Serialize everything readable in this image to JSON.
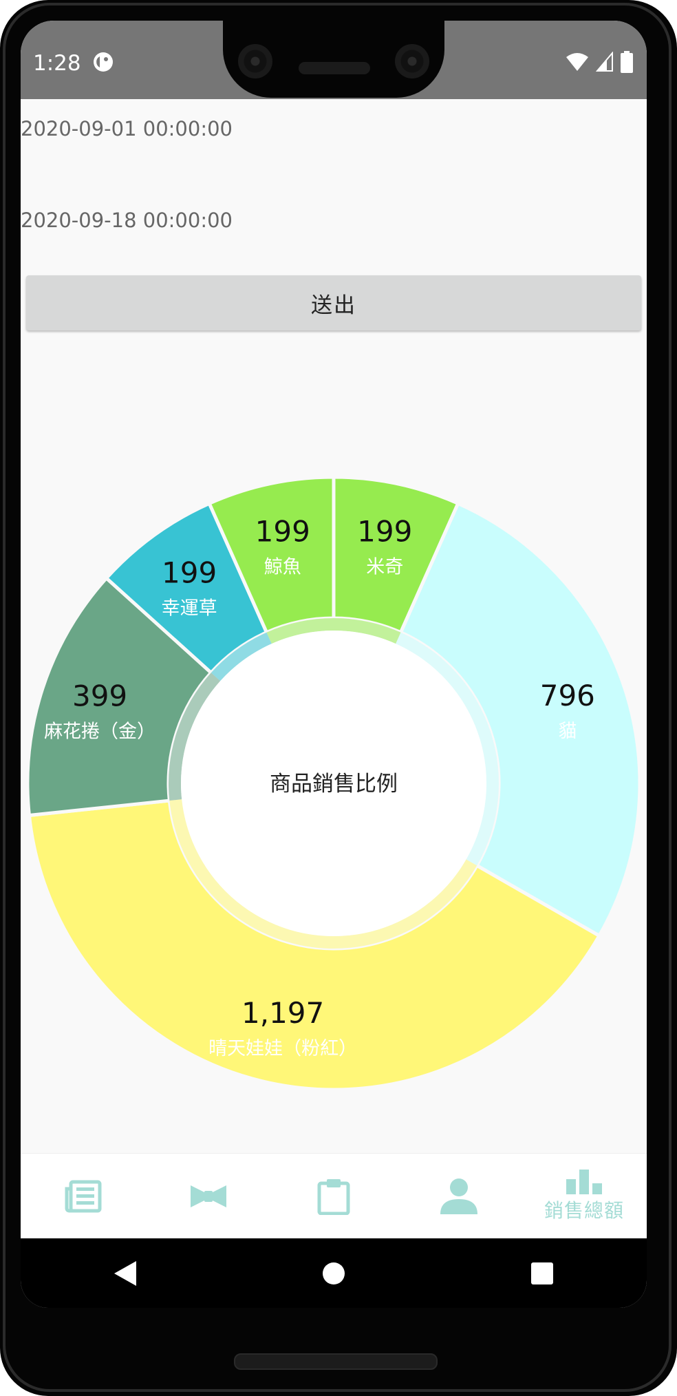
{
  "status_bar": {
    "time": "1:28",
    "app_icon": "app-notification-icon",
    "right_icons": [
      "wifi-icon",
      "cell-signal-icon",
      "battery-icon"
    ],
    "background_color": "#767676"
  },
  "form": {
    "start_date": "2020-09-01 00:00:00",
    "end_date": "2020-09-18 00:00:00",
    "submit_label": "送出"
  },
  "chart_data": {
    "type": "pie",
    "center_label": "商品銷售比例",
    "slices": [
      {
        "label": "米奇",
        "value": 199,
        "value_text": "199",
        "color": "#96eb4f"
      },
      {
        "label": "貓",
        "value": 796,
        "value_text": "796",
        "color": "#c9fdfd"
      },
      {
        "label": "晴天娃娃（粉紅）",
        "value": 1197,
        "value_text": "1,197",
        "color": "#fff778"
      },
      {
        "label": "麻花捲（金）",
        "value": 399,
        "value_text": "399",
        "color": "#6aa687"
      },
      {
        "label": "幸運草",
        "value": 199,
        "value_text": "199",
        "color": "#38c3d3"
      },
      {
        "label": "鯨魚",
        "value": 199,
        "value_text": "199",
        "color": "#96eb4f"
      }
    ]
  },
  "bottom_nav": {
    "items": [
      {
        "icon": "news-icon"
      },
      {
        "icon": "bow-tie-icon"
      },
      {
        "icon": "clipboard-icon"
      },
      {
        "icon": "person-icon"
      },
      {
        "icon": "bar-chart-icon",
        "label": "銷售總額"
      }
    ],
    "accent_color": "#a4dcd5"
  },
  "system_nav": {
    "icons": [
      "back-icon",
      "home-icon",
      "recents-icon"
    ]
  }
}
